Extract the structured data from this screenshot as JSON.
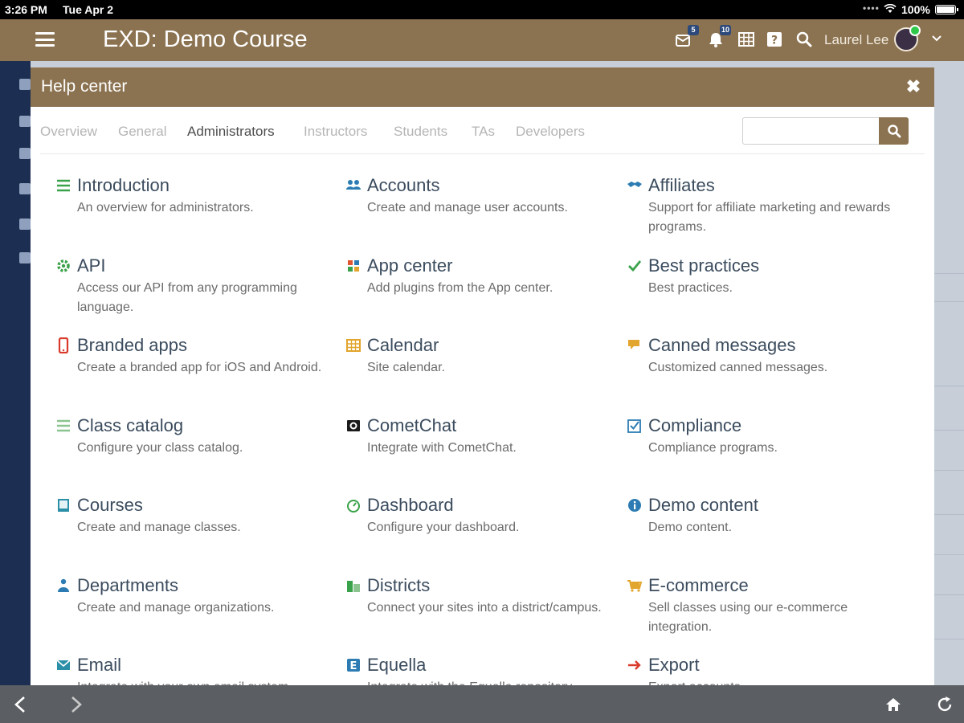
{
  "status_bar": {
    "time": "3:26 PM",
    "date": "Tue Apr 2",
    "battery": "100%"
  },
  "app_header": {
    "course_title": "EXD: Demo Course",
    "notifications_badge": "5",
    "alerts_badge": "10",
    "user_name": "Laurel Lee"
  },
  "help_center": {
    "title": "Help center",
    "close_glyph": "✖",
    "tabs": [
      {
        "label": "Overview"
      },
      {
        "label": "General"
      },
      {
        "label": "Administrators"
      },
      {
        "label": "Instructors"
      },
      {
        "label": "Students"
      },
      {
        "label": "TAs"
      },
      {
        "label": "Developers"
      }
    ],
    "active_tab": "Administrators",
    "search": {
      "value": "",
      "placeholder": ""
    },
    "topics": [
      {
        "title": "Introduction",
        "desc": "An overview for administrators.",
        "icon": "list-icon",
        "color": "#3aa24a"
      },
      {
        "title": "Accounts",
        "desc": "Create and manage user accounts.",
        "icon": "users-icon",
        "color": "#2c7cb3"
      },
      {
        "title": "Affiliates",
        "desc": "Support for affiliate marketing and rewards programs.",
        "icon": "handshake-icon",
        "color": "#2c7cb3"
      },
      {
        "title": "API",
        "desc": "Access our API from any programming language.",
        "icon": "gear-icon",
        "color": "#3aa24a"
      },
      {
        "title": "App center",
        "desc": "Add plugins from the App center.",
        "icon": "puzzle-icon",
        "color": "#e0562f"
      },
      {
        "title": "Best practices",
        "desc": "Best practices.",
        "icon": "check-icon",
        "color": "#3aa24a"
      },
      {
        "title": "Branded apps",
        "desc": "Create a branded app for iOS and Android.",
        "icon": "phone-icon",
        "color": "#d93a2b"
      },
      {
        "title": "Calendar",
        "desc": "Site calendar.",
        "icon": "calendar-icon",
        "color": "#e2a52d"
      },
      {
        "title": "Canned messages",
        "desc": "Customized canned messages.",
        "icon": "chat-icon",
        "color": "#e2a52d"
      },
      {
        "title": "Class catalog",
        "desc": "Configure your class catalog.",
        "icon": "catalog-icon",
        "color": "#3aa24a"
      },
      {
        "title": "CometChat",
        "desc": "Integrate with CometChat.",
        "icon": "cometchat-icon",
        "color": "#1a1a1a"
      },
      {
        "title": "Compliance",
        "desc": "Compliance programs.",
        "icon": "checkbox-icon",
        "color": "#2c7cb3"
      },
      {
        "title": "Courses",
        "desc": "Create and manage classes.",
        "icon": "book-icon",
        "color": "#2c8fa8"
      },
      {
        "title": "Dashboard",
        "desc": "Configure your dashboard.",
        "icon": "dashboard-icon",
        "color": "#3aa24a"
      },
      {
        "title": "Demo content",
        "desc": "Demo content.",
        "icon": "info-icon",
        "color": "#2c7cb3"
      },
      {
        "title": "Departments",
        "desc": "Create and manage organizations.",
        "icon": "org-icon",
        "color": "#2c7cb3"
      },
      {
        "title": "Districts",
        "desc": "Connect your sites into a district/campus.",
        "icon": "districts-icon",
        "color": "#3aa24a"
      },
      {
        "title": "E-commerce",
        "desc": "Sell classes using our e-commerce integration.",
        "icon": "cart-icon",
        "color": "#e2a52d"
      },
      {
        "title": "Email",
        "desc": "Integrate with your own email system.",
        "icon": "envelope-icon",
        "color": "#2c8fa8"
      },
      {
        "title": "Equella",
        "desc": "Integrate with the Equella repository.",
        "icon": "equella-icon",
        "color": "#2c7cb3"
      },
      {
        "title": "Export",
        "desc": "Export accounts.",
        "icon": "arrow-right-icon",
        "color": "#d93a2b"
      }
    ]
  },
  "bottom_bar": {
    "back_icon": "back-icon",
    "forward_icon": "forward-icon",
    "home_icon": "home-icon",
    "reload_icon": "reload-icon"
  }
}
